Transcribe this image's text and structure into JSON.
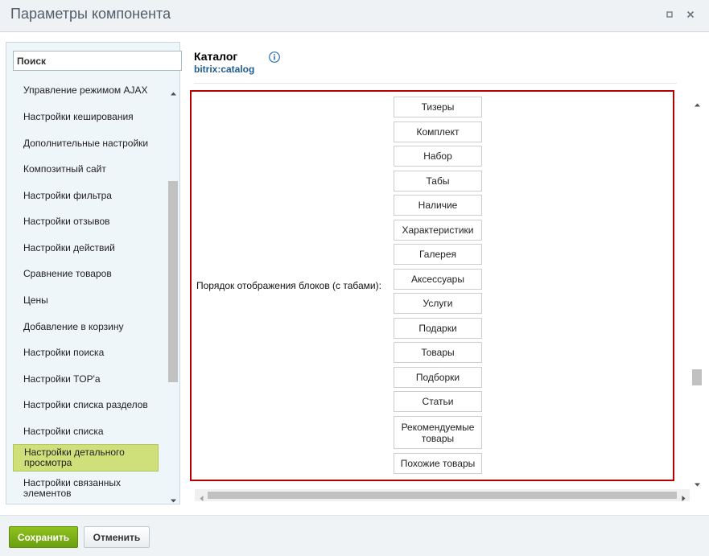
{
  "window": {
    "title": "Параметры компонента"
  },
  "sidebar": {
    "search_placeholder": "Поиск",
    "items": [
      {
        "label": "Управление режимом AJAX"
      },
      {
        "label": "Настройки кеширования"
      },
      {
        "label": "Дополнительные настройки"
      },
      {
        "label": "Композитный сайт"
      },
      {
        "label": "Настройки фильтра"
      },
      {
        "label": "Настройки отзывов"
      },
      {
        "label": "Настройки действий"
      },
      {
        "label": "Сравнение товаров"
      },
      {
        "label": "Цены"
      },
      {
        "label": "Добавление в корзину"
      },
      {
        "label": "Настройки поиска"
      },
      {
        "label": "Настройки TOP'а"
      },
      {
        "label": "Настройки списка разделов"
      },
      {
        "label": "Настройки списка"
      },
      {
        "label": "Настройки детального просмотра",
        "active": true
      },
      {
        "label": "Настройки связанных элементов"
      }
    ]
  },
  "component": {
    "title": "Каталог",
    "code": "bitrix:catalog"
  },
  "field": {
    "label": "Порядок отображения блоков (с табами):",
    "blocks": [
      "Тизеры",
      "Комплект",
      "Набор",
      "Табы",
      "Наличие",
      "Характеристики",
      "Галерея",
      "Аксессуары",
      "Услуги",
      "Подарки",
      "Товары",
      "Подборки",
      "Статьи",
      "Рекомендуемые товары",
      "Похожие товары"
    ]
  },
  "footer": {
    "save_label": "Сохранить",
    "cancel_label": "Отменить"
  },
  "colors": {
    "accent_green": "#7ab317",
    "highlight_red": "#b30000",
    "active_item": "#cfe07a",
    "link_blue": "#1f5c8e"
  }
}
